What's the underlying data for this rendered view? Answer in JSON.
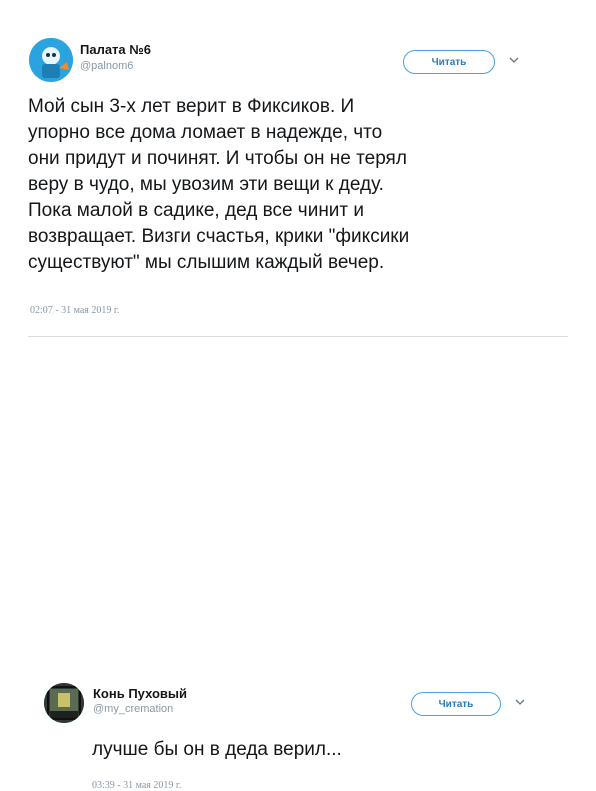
{
  "tweet1": {
    "display_name": "Палата №6",
    "handle": "@palnom6",
    "follow_label": "Читать",
    "text": "Мой сын 3-х лет верит в Фиксиков. И\nупорно все дома ломает в надежде, что\nони придут и починят. И чтобы он не терял\nверу в чудо, мы увозим эти вещи к деду.\nПока малой в садике, дед все чинит и\nвозвращает. Визги счастья, крики \"фиксики\nсуществуют\" мы слышим каждый вечер.",
    "timestamp": "02:07 - 31 мая 2019 г."
  },
  "tweet2": {
    "display_name": "Конь Пуховый",
    "handle": "@my_cremation",
    "follow_label": "Читать",
    "text": "лучше бы он в деда верил...",
    "timestamp": "03:39 - 31 мая 2019 г."
  },
  "colors": {
    "accent": "#2b7bb9",
    "muted": "#8899a6",
    "text": "#14171a"
  },
  "icons": {
    "caret": "chevron-down-icon",
    "avatar1": "fixie-avatar-icon",
    "avatar2": "room-avatar-icon"
  }
}
